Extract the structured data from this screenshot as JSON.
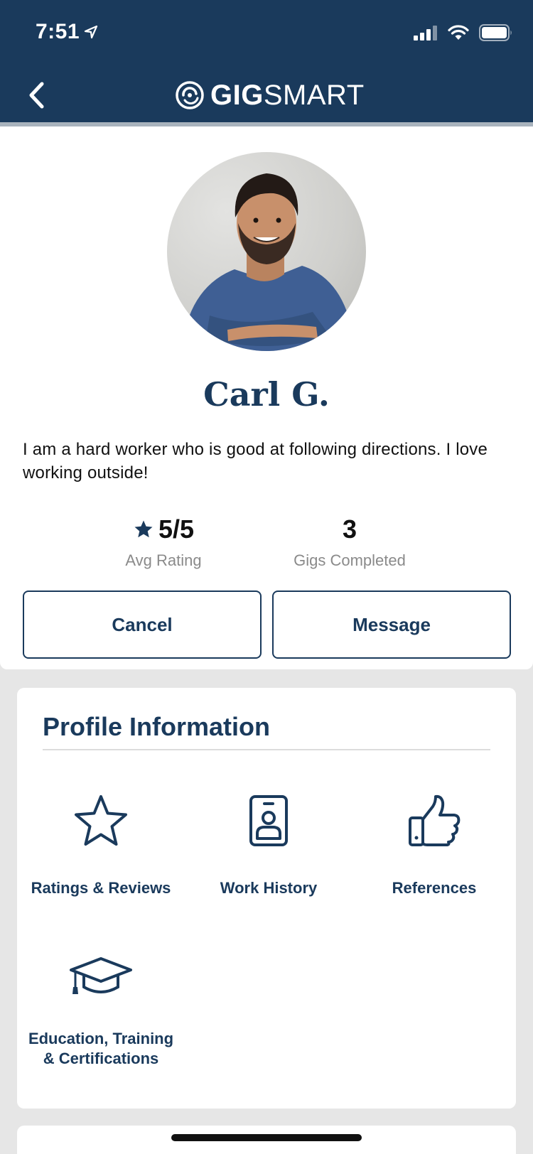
{
  "status_bar": {
    "time": "7:51"
  },
  "header": {
    "logo_bold": "GIG",
    "logo_light": "SMART"
  },
  "profile": {
    "name": "Carl G.",
    "bio": "I am a hard worker who is good at following directions. I love working outside!",
    "stats": {
      "rating_value": "5/5",
      "rating_label": "Avg Rating",
      "gigs_value": "3",
      "gigs_label": "Gigs Completed"
    },
    "buttons": {
      "cancel": "Cancel",
      "message": "Message"
    }
  },
  "profile_info": {
    "title": "Profile Information",
    "items": [
      {
        "label": "Ratings & Reviews",
        "icon": "star-outline-icon"
      },
      {
        "label": "Work History",
        "icon": "id-badge-icon"
      },
      {
        "label": "References",
        "icon": "thumbs-up-icon"
      },
      {
        "label_line1": "Education, Training",
        "label_line2": "& Certifications",
        "icon": "graduation-cap-icon"
      }
    ]
  },
  "colors": {
    "brand_navy": "#1a3a5c",
    "background": "#e6e6e6",
    "muted_text": "#8a8a8a"
  }
}
